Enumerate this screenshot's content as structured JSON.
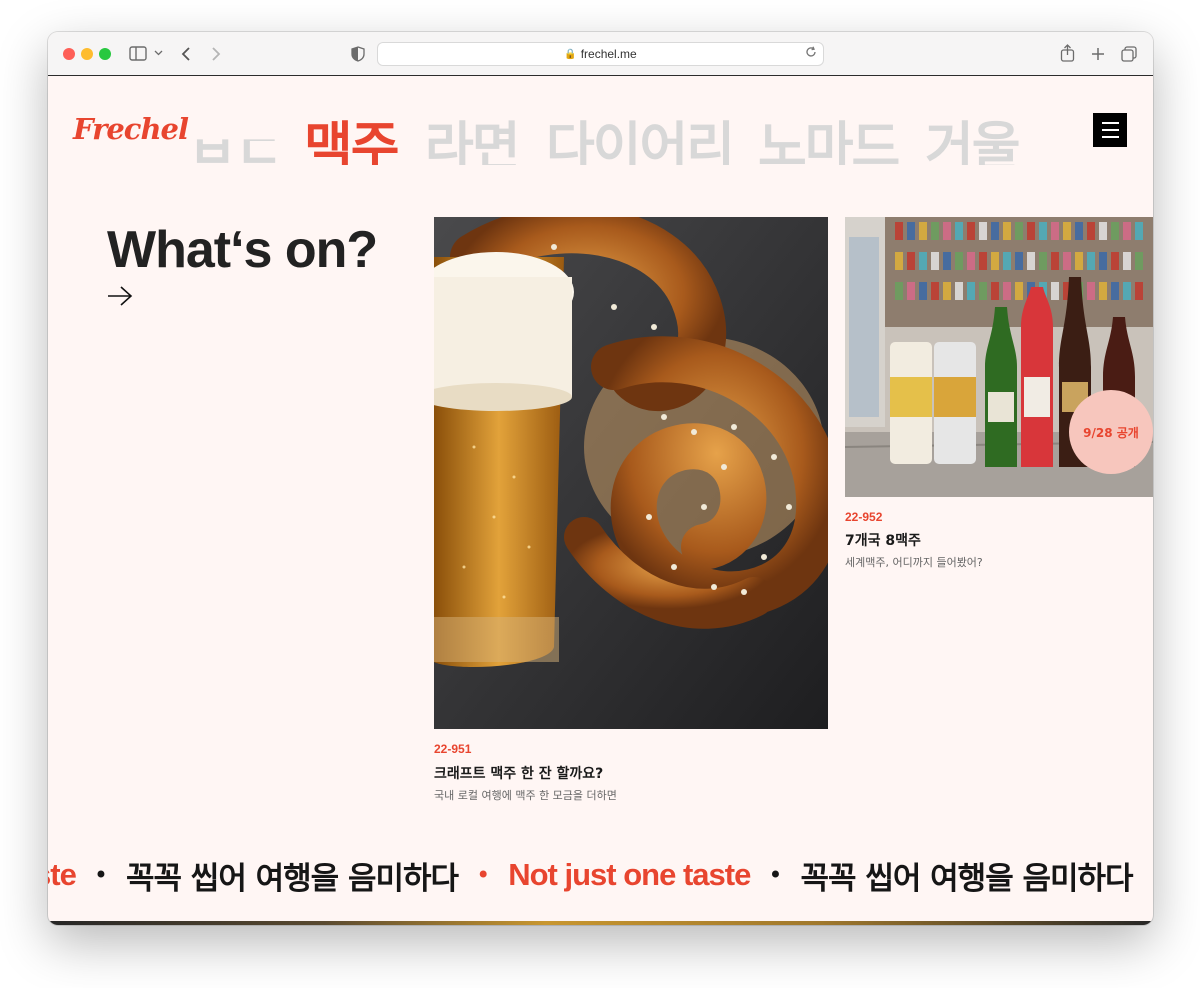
{
  "browser": {
    "url": "frechel.me"
  },
  "header": {
    "logo": "Frechel",
    "categories": [
      {
        "label": "ㅂㄷ",
        "active": false
      },
      {
        "label": "맥주",
        "active": true
      },
      {
        "label": "라면",
        "active": false
      },
      {
        "label": "다이어리",
        "active": false
      },
      {
        "label": "노마드",
        "active": false
      },
      {
        "label": "거울",
        "active": false
      }
    ]
  },
  "hero": {
    "heading": "What‘s on?"
  },
  "cards": [
    {
      "code": "22-951",
      "title": "크래프트 맥주 한 잔 할까요?",
      "subtitle": "국내 로컬 여행에 맥주 한 모금을 더하면"
    },
    {
      "code": "22-952",
      "title": "7개국 8맥주",
      "subtitle": "세계맥주, 어디까지 들어봤어?",
      "badge": "9/28 공개"
    }
  ],
  "ticker": {
    "items": [
      {
        "text": "ste",
        "red": true
      },
      {
        "text": "꼭꼭 씹어 여행을 음미하다",
        "red": false
      },
      {
        "text": "Not just one taste",
        "red": true
      },
      {
        "text": "꼭꼭 씹어 여행을 음미하다",
        "red": false
      }
    ]
  }
}
